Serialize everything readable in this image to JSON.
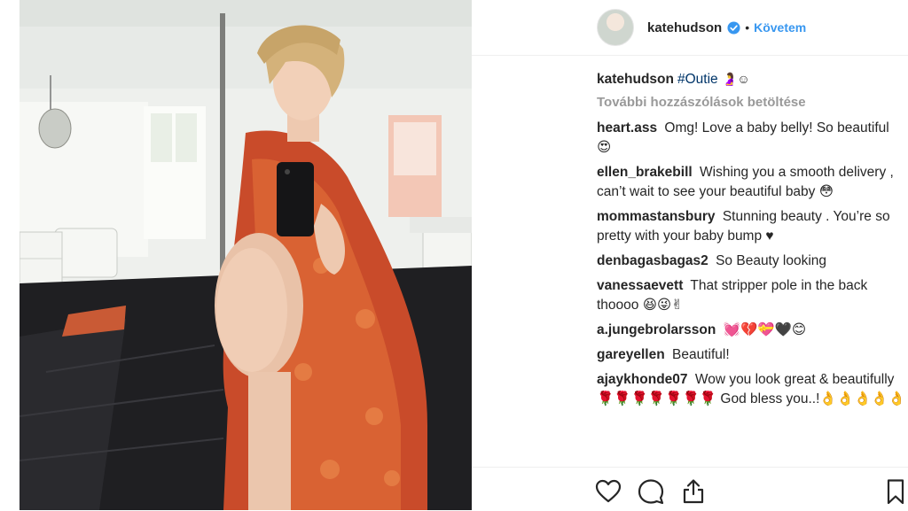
{
  "header": {
    "username": "katehudson",
    "separator": "•",
    "follow_label": "Követem"
  },
  "caption": {
    "username": "katehudson",
    "hashtag": "#Outie",
    "emojis": "🤰☺"
  },
  "load_more_label": "További hozzászólások betöltése",
  "comments": [
    {
      "user": "heart.ass",
      "text": "Omg! Love a baby belly! So beautiful 😍"
    },
    {
      "user": "ellen_brakebill",
      "text": "Wishing you a smooth delivery , can’t wait to see your beautiful baby 😳"
    },
    {
      "user": "mommastansbury",
      "text": "Stunning beauty . You’re so pretty with your baby bump ♥"
    },
    {
      "user": "denbagasbagas2",
      "text": "So Beauty looking"
    },
    {
      "user": "vanessaevett",
      "text": "That stripper pole in the back thoooo 😆😜✌"
    },
    {
      "user": "a.jungebrolarsson",
      "text": "💓💔💝🖤😊"
    },
    {
      "user": "gareyellen",
      "text": "Beautiful!"
    },
    {
      "user": "ajaykhonde07",
      "text": "Wow you look great & beautifully 🌹🌹🌹🌹🌹🌹🌹 God bless you..!👌👌👌👌👌"
    }
  ],
  "icons": {
    "avatar": "profile-avatar",
    "verified": "verified-badge-icon",
    "like": "heart-icon",
    "comment": "comment-bubble-icon",
    "share": "share-icon",
    "save": "bookmark-icon"
  },
  "colors": {
    "link": "#3897f0",
    "hashtag": "#003569",
    "muted": "#999999",
    "text": "#262626"
  }
}
